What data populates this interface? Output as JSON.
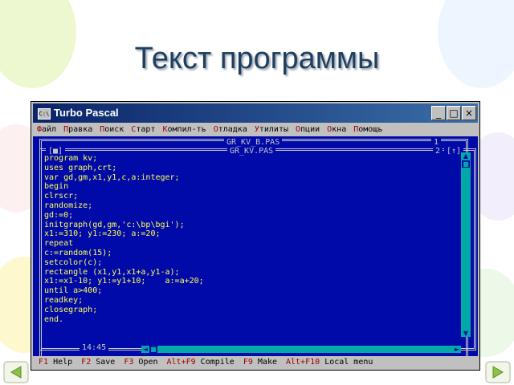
{
  "slide": {
    "title": "Текст программы"
  },
  "window": {
    "app_title": "Turbo Pascal",
    "icon_label": "C:\\",
    "buttons": {
      "minimize": "_",
      "maximize": "□",
      "close": "×"
    }
  },
  "menu": {
    "items": [
      {
        "hot": "Ф",
        "rest": "айл"
      },
      {
        "hot": "П",
        "rest": "равка"
      },
      {
        "hot": "П",
        "rest": "оиск"
      },
      {
        "hot": "С",
        "rest": "тарт"
      },
      {
        "hot": "К",
        "rest": "омпил-ть"
      },
      {
        "hot": "О",
        "rest": "тладка"
      },
      {
        "hot": "У",
        "rest": "тилиты"
      },
      {
        "hot": "О",
        "rest": "пции"
      },
      {
        "hot": "О",
        "rest": "кна"
      },
      {
        "hot": "П",
        "rest": "омощь"
      }
    ]
  },
  "editor": {
    "back_window_title": "GR_KV_B.PAS",
    "back_window_number": "1",
    "front_window_title": "GR_KV.PAS",
    "front_window_number": "2",
    "close_box": "[■]",
    "zoom_box": "[↑]",
    "cursor_position": "14:45",
    "code": "program kv;\nuses graph,crt;\nvar gd,gm,x1,y1,c,a:integer;\nbegin\nclrscr;\nrandomize;\ngd:=0;\ninitgraph(gd,gm,'c:\\bp\\bgi');\nx1:=310; y1:=230; a:=20;\nrepeat\nc:=random(15);\nsetcolor(c);\nrectangle (x1,y1,x1+a,y1-a);\nx1:=x1-10; y1:=y1+10;    a:=a+20;\nuntil a>400;\nreadkey;\nclosegraph;\nend."
  },
  "statusbar": {
    "items": [
      {
        "key": "F1",
        "label": "Help"
      },
      {
        "key": "F2",
        "label": "Save"
      },
      {
        "key": "F3",
        "label": "Open"
      },
      {
        "key": "Alt+F9",
        "label": "Compile"
      },
      {
        "key": "F9",
        "label": "Make"
      },
      {
        "key": "Alt+F10",
        "label": "Local menu"
      }
    ]
  }
}
